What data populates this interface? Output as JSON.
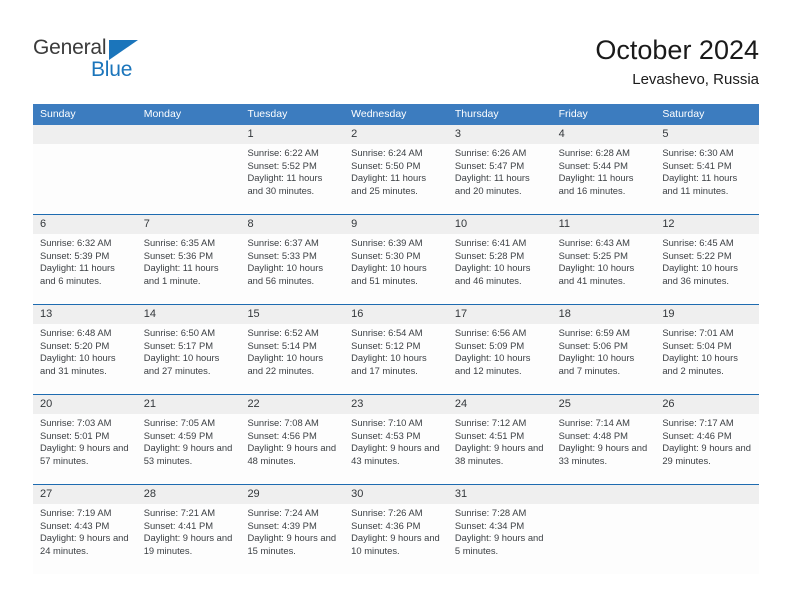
{
  "brand": {
    "name_part1": "General",
    "name_part2": "Blue",
    "accent_color": "#1b75bb",
    "triangle_icon": "blue-triangle-icon"
  },
  "header": {
    "title": "October 2024",
    "subtitle": "Levashevo, Russia"
  },
  "calendar": {
    "header_color": "#3c7cbf",
    "weekdays": [
      "Sunday",
      "Monday",
      "Tuesday",
      "Wednesday",
      "Thursday",
      "Friday",
      "Saturday"
    ],
    "weeks": [
      [
        {
          "day": "",
          "sunrise": "",
          "sunset": "",
          "daylight": "",
          "empty": true
        },
        {
          "day": "",
          "sunrise": "",
          "sunset": "",
          "daylight": "",
          "empty": true
        },
        {
          "day": "1",
          "sunrise": "Sunrise: 6:22 AM",
          "sunset": "Sunset: 5:52 PM",
          "daylight": "Daylight: 11 hours and 30 minutes."
        },
        {
          "day": "2",
          "sunrise": "Sunrise: 6:24 AM",
          "sunset": "Sunset: 5:50 PM",
          "daylight": "Daylight: 11 hours and 25 minutes."
        },
        {
          "day": "3",
          "sunrise": "Sunrise: 6:26 AM",
          "sunset": "Sunset: 5:47 PM",
          "daylight": "Daylight: 11 hours and 20 minutes."
        },
        {
          "day": "4",
          "sunrise": "Sunrise: 6:28 AM",
          "sunset": "Sunset: 5:44 PM",
          "daylight": "Daylight: 11 hours and 16 minutes."
        },
        {
          "day": "5",
          "sunrise": "Sunrise: 6:30 AM",
          "sunset": "Sunset: 5:41 PM",
          "daylight": "Daylight: 11 hours and 11 minutes."
        }
      ],
      [
        {
          "day": "6",
          "sunrise": "Sunrise: 6:32 AM",
          "sunset": "Sunset: 5:39 PM",
          "daylight": "Daylight: 11 hours and 6 minutes."
        },
        {
          "day": "7",
          "sunrise": "Sunrise: 6:35 AM",
          "sunset": "Sunset: 5:36 PM",
          "daylight": "Daylight: 11 hours and 1 minute."
        },
        {
          "day": "8",
          "sunrise": "Sunrise: 6:37 AM",
          "sunset": "Sunset: 5:33 PM",
          "daylight": "Daylight: 10 hours and 56 minutes."
        },
        {
          "day": "9",
          "sunrise": "Sunrise: 6:39 AM",
          "sunset": "Sunset: 5:30 PM",
          "daylight": "Daylight: 10 hours and 51 minutes."
        },
        {
          "day": "10",
          "sunrise": "Sunrise: 6:41 AM",
          "sunset": "Sunset: 5:28 PM",
          "daylight": "Daylight: 10 hours and 46 minutes."
        },
        {
          "day": "11",
          "sunrise": "Sunrise: 6:43 AM",
          "sunset": "Sunset: 5:25 PM",
          "daylight": "Daylight: 10 hours and 41 minutes."
        },
        {
          "day": "12",
          "sunrise": "Sunrise: 6:45 AM",
          "sunset": "Sunset: 5:22 PM",
          "daylight": "Daylight: 10 hours and 36 minutes."
        }
      ],
      [
        {
          "day": "13",
          "sunrise": "Sunrise: 6:48 AM",
          "sunset": "Sunset: 5:20 PM",
          "daylight": "Daylight: 10 hours and 31 minutes."
        },
        {
          "day": "14",
          "sunrise": "Sunrise: 6:50 AM",
          "sunset": "Sunset: 5:17 PM",
          "daylight": "Daylight: 10 hours and 27 minutes."
        },
        {
          "day": "15",
          "sunrise": "Sunrise: 6:52 AM",
          "sunset": "Sunset: 5:14 PM",
          "daylight": "Daylight: 10 hours and 22 minutes."
        },
        {
          "day": "16",
          "sunrise": "Sunrise: 6:54 AM",
          "sunset": "Sunset: 5:12 PM",
          "daylight": "Daylight: 10 hours and 17 minutes."
        },
        {
          "day": "17",
          "sunrise": "Sunrise: 6:56 AM",
          "sunset": "Sunset: 5:09 PM",
          "daylight": "Daylight: 10 hours and 12 minutes."
        },
        {
          "day": "18",
          "sunrise": "Sunrise: 6:59 AM",
          "sunset": "Sunset: 5:06 PM",
          "daylight": "Daylight: 10 hours and 7 minutes."
        },
        {
          "day": "19",
          "sunrise": "Sunrise: 7:01 AM",
          "sunset": "Sunset: 5:04 PM",
          "daylight": "Daylight: 10 hours and 2 minutes."
        }
      ],
      [
        {
          "day": "20",
          "sunrise": "Sunrise: 7:03 AM",
          "sunset": "Sunset: 5:01 PM",
          "daylight": "Daylight: 9 hours and 57 minutes."
        },
        {
          "day": "21",
          "sunrise": "Sunrise: 7:05 AM",
          "sunset": "Sunset: 4:59 PM",
          "daylight": "Daylight: 9 hours and 53 minutes."
        },
        {
          "day": "22",
          "sunrise": "Sunrise: 7:08 AM",
          "sunset": "Sunset: 4:56 PM",
          "daylight": "Daylight: 9 hours and 48 minutes."
        },
        {
          "day": "23",
          "sunrise": "Sunrise: 7:10 AM",
          "sunset": "Sunset: 4:53 PM",
          "daylight": "Daylight: 9 hours and 43 minutes."
        },
        {
          "day": "24",
          "sunrise": "Sunrise: 7:12 AM",
          "sunset": "Sunset: 4:51 PM",
          "daylight": "Daylight: 9 hours and 38 minutes."
        },
        {
          "day": "25",
          "sunrise": "Sunrise: 7:14 AM",
          "sunset": "Sunset: 4:48 PM",
          "daylight": "Daylight: 9 hours and 33 minutes."
        },
        {
          "day": "26",
          "sunrise": "Sunrise: 7:17 AM",
          "sunset": "Sunset: 4:46 PM",
          "daylight": "Daylight: 9 hours and 29 minutes."
        }
      ],
      [
        {
          "day": "27",
          "sunrise": "Sunrise: 7:19 AM",
          "sunset": "Sunset: 4:43 PM",
          "daylight": "Daylight: 9 hours and 24 minutes."
        },
        {
          "day": "28",
          "sunrise": "Sunrise: 7:21 AM",
          "sunset": "Sunset: 4:41 PM",
          "daylight": "Daylight: 9 hours and 19 minutes."
        },
        {
          "day": "29",
          "sunrise": "Sunrise: 7:24 AM",
          "sunset": "Sunset: 4:39 PM",
          "daylight": "Daylight: 9 hours and 15 minutes."
        },
        {
          "day": "30",
          "sunrise": "Sunrise: 7:26 AM",
          "sunset": "Sunset: 4:36 PM",
          "daylight": "Daylight: 9 hours and 10 minutes."
        },
        {
          "day": "31",
          "sunrise": "Sunrise: 7:28 AM",
          "sunset": "Sunset: 4:34 PM",
          "daylight": "Daylight: 9 hours and 5 minutes."
        },
        {
          "day": "",
          "sunrise": "",
          "sunset": "",
          "daylight": "",
          "empty": true
        },
        {
          "day": "",
          "sunrise": "",
          "sunset": "",
          "daylight": "",
          "empty": true
        }
      ]
    ]
  }
}
